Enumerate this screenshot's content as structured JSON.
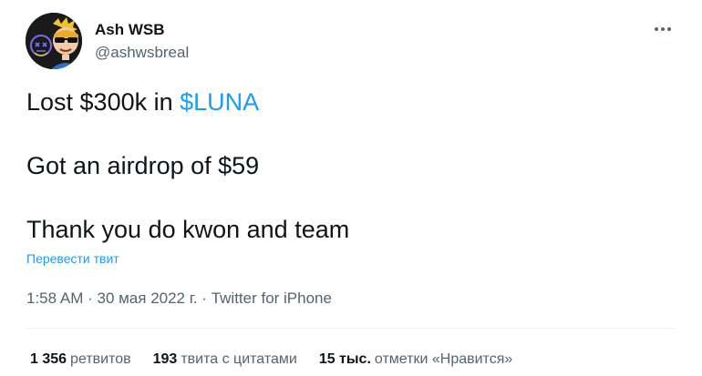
{
  "tweet": {
    "author": {
      "name": "Ash WSB",
      "handle": "@ashwsbreal"
    },
    "more_icon": "more-horizontal-icon",
    "text": {
      "line1_before": "Lost $300k in ",
      "line1_cashtag": "$LUNA",
      "line2": "Got an airdrop of $59",
      "line3": "Thank you do kwon and team"
    },
    "translate_link": "Перевести твит",
    "time": "1:58 AM",
    "date": "30 мая 2022 г.",
    "separator": " · ",
    "source": "Twitter for iPhone",
    "stats": {
      "retweets_count": "1 356",
      "retweets_label": "ретвитов",
      "quotes_count": "193",
      "quotes_label": "твита с цитатами",
      "likes_count": "15 тыс.",
      "likes_label": "отметки «Нравится»"
    },
    "colors": {
      "link": "#1d9bf0",
      "text": "#0f1419",
      "secondary": "#536471"
    }
  }
}
